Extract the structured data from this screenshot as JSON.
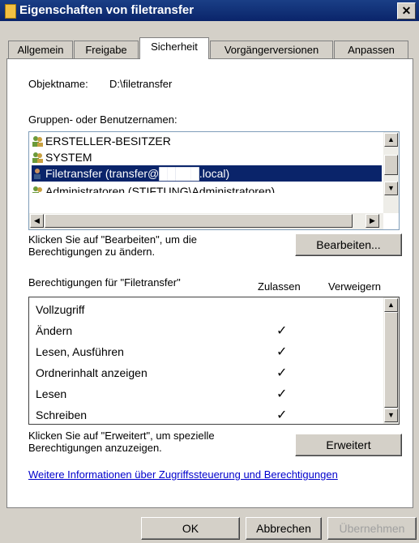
{
  "window": {
    "title": "Eigenschaften von filetransfer",
    "close_label": "✕"
  },
  "tabs": [
    {
      "label": "Allgemein",
      "active": false
    },
    {
      "label": "Freigabe",
      "active": false
    },
    {
      "label": "Sicherheit",
      "active": true
    },
    {
      "label": "Vorgängerversionen",
      "active": false
    },
    {
      "label": "Anpassen",
      "active": false
    }
  ],
  "object": {
    "label": "Objektname:",
    "value": "D:\\filetransfer"
  },
  "groups": {
    "label": "Gruppen- oder Benutzernamen:",
    "items": [
      {
        "name": "ERSTELLER-BESITZER",
        "selected": false
      },
      {
        "name": "SYSTEM",
        "selected": false
      },
      {
        "name": "Filetransfer (transfer@█████.local)",
        "selected": true
      },
      {
        "name": "Administratoren (STIFTUNG\\Administratoren)",
        "selected": false
      }
    ]
  },
  "edit": {
    "hint": "Klicken Sie auf \"Bearbeiten\", um die Berechtigungen zu ändern.",
    "button": "Bearbeiten..."
  },
  "permissions": {
    "label": "Berechtigungen für \"Filetransfer\"",
    "allow_header": "Zulassen",
    "deny_header": "Verweigern",
    "items": [
      {
        "name": "Vollzugriff",
        "allow": ""
      },
      {
        "name": "Ändern",
        "allow": "✓"
      },
      {
        "name": "Lesen, Ausführen",
        "allow": "✓"
      },
      {
        "name": "Ordnerinhalt anzeigen",
        "allow": "✓"
      },
      {
        "name": "Lesen",
        "allow": "✓"
      },
      {
        "name": "Schreiben",
        "allow": "✓"
      }
    ]
  },
  "advanced": {
    "hint": "Klicken Sie auf \"Erweitert\", um spezielle Berechtigungen anzuzeigen.",
    "button": "Erweitert"
  },
  "more_info_link": "Weitere Informationen über Zugriffssteuerung und Berechtigungen",
  "footer": {
    "ok": "OK",
    "cancel": "Abbrechen",
    "apply": "Übernehmen"
  }
}
